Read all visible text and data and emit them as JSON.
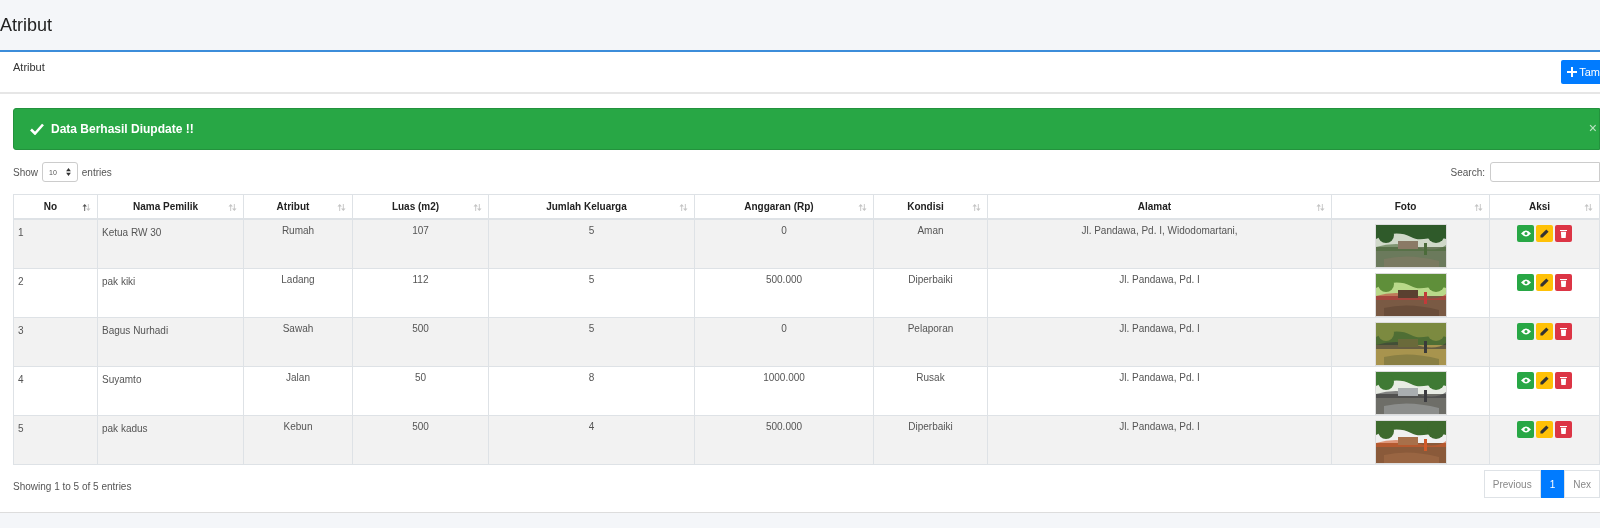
{
  "page_title": "Atribut",
  "card": {
    "title": "Atribut",
    "add_button": "Tam"
  },
  "alert": {
    "kind": "success",
    "message": "Data Berhasil Diupdate !!",
    "close": "×"
  },
  "length": {
    "show": "Show",
    "value": "10",
    "entries": "entries"
  },
  "search": {
    "label": "Search:"
  },
  "table": {
    "columns": [
      {
        "label": "No",
        "sorted": true
      },
      {
        "label": "Nama Pemilik",
        "sorted": false
      },
      {
        "label": "Atribut",
        "sorted": false
      },
      {
        "label": "Luas (m2)",
        "sorted": false
      },
      {
        "label": "Jumlah Keluarga",
        "sorted": false
      },
      {
        "label": "Anggaran (Rp)",
        "sorted": false
      },
      {
        "label": "Kondisi",
        "sorted": false
      },
      {
        "label": "Alamat",
        "sorted": false
      },
      {
        "label": "Foto",
        "sorted": false
      },
      {
        "label": "Aksi",
        "sorted": false
      }
    ],
    "row_actions": [
      {
        "kind": "view"
      },
      {
        "kind": "edit"
      },
      {
        "kind": "delete"
      }
    ],
    "rows": [
      {
        "cells": [
          "1",
          "Ketua RW 30",
          "Rumah",
          "107",
          "5",
          "0",
          "Aman",
          "Jl. Pandawa, Pd. I, Widodomartani,"
        ]
      },
      {
        "cells": [
          "2",
          "pak kiki",
          "Ladang",
          "112",
          "5",
          "500.000",
          "Diperbaiki",
          "Jl. Pandawa, Pd. I"
        ]
      },
      {
        "cells": [
          "3",
          "Bagus Nurhadi",
          "Sawah",
          "500",
          "5",
          "0",
          "Pelaporan",
          "Jl. Pandawa, Pd. I"
        ]
      },
      {
        "cells": [
          "4",
          "Suyamto",
          "Jalan",
          "50",
          "8",
          "1000.000",
          "Rusak",
          "Jl. Pandawa, Pd. I"
        ]
      },
      {
        "cells": [
          "5",
          "pak kadus",
          "Kebun",
          "500",
          "4",
          "500.000",
          "Diperbaiki",
          "Jl. Pandawa, Pd. I"
        ]
      }
    ]
  },
  "info": "Showing 1 to 5 of 5 entries",
  "pagination": [
    {
      "label": "Previous",
      "selected": false
    },
    {
      "label": "1",
      "selected": true
    },
    {
      "label": "Nex",
      "selected": false
    }
  ]
}
